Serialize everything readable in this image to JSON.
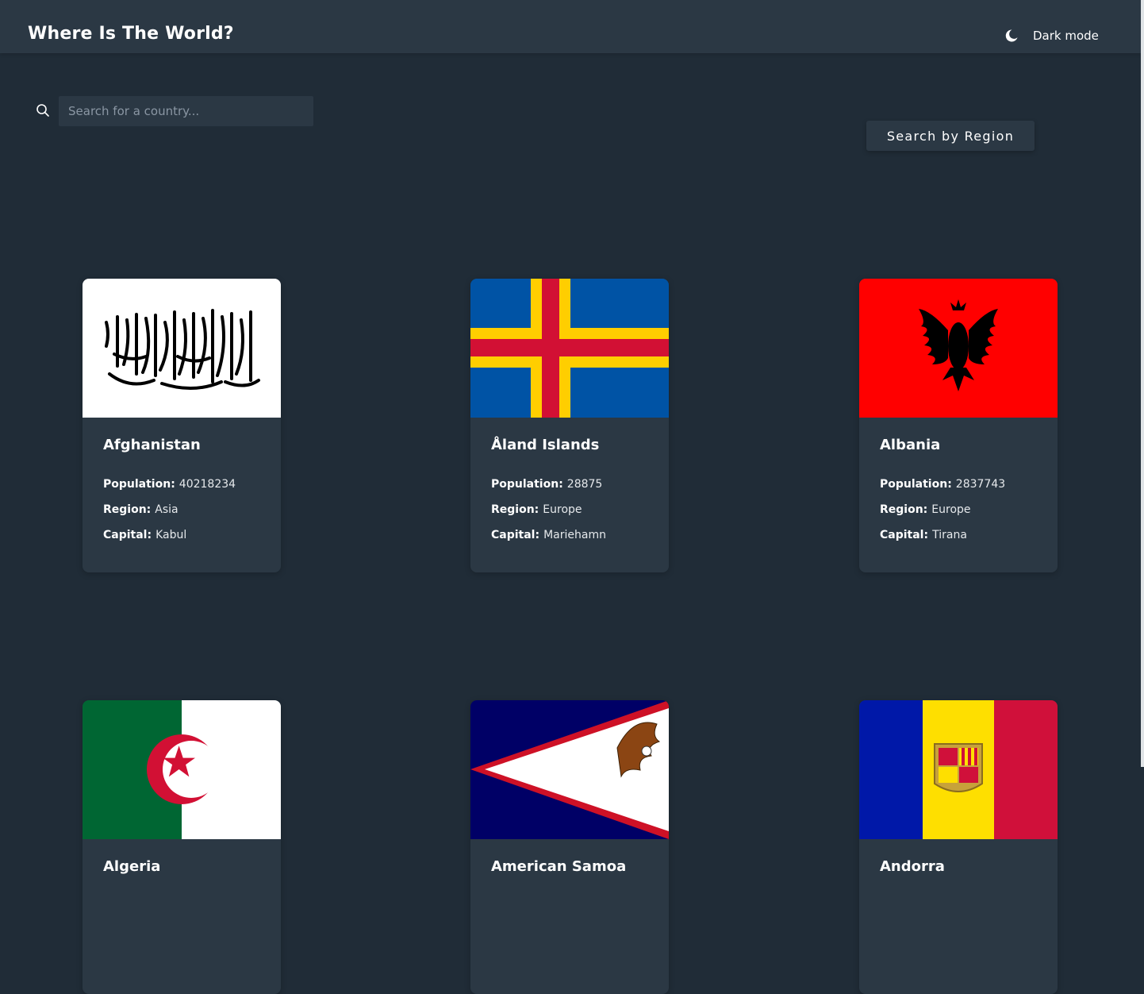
{
  "header": {
    "title": "Where Is The World?",
    "mode_label": "Dark mode",
    "mode_icon": "moon-icon"
  },
  "search": {
    "placeholder": "Search for a country...",
    "value": ""
  },
  "filter": {
    "label": "Search by Region"
  },
  "labels": {
    "population": "Population:",
    "region": "Region:",
    "capital": "Capital:"
  },
  "countries": [
    {
      "name": "Afghanistan",
      "population": "40218234",
      "region": "Asia",
      "capital": "Kabul"
    },
    {
      "name": "Åland Islands",
      "population": "28875",
      "region": "Europe",
      "capital": "Mariehamn"
    },
    {
      "name": "Albania",
      "population": "2837743",
      "region": "Europe",
      "capital": "Tirana"
    },
    {
      "name": "Algeria",
      "population": "",
      "region": "",
      "capital": ""
    },
    {
      "name": "American Samoa",
      "population": "",
      "region": "",
      "capital": ""
    },
    {
      "name": "Andorra",
      "population": "",
      "region": "",
      "capital": ""
    }
  ],
  "colors": {
    "background": "#202c37",
    "element": "#2b3844",
    "text": "#ffffff"
  }
}
